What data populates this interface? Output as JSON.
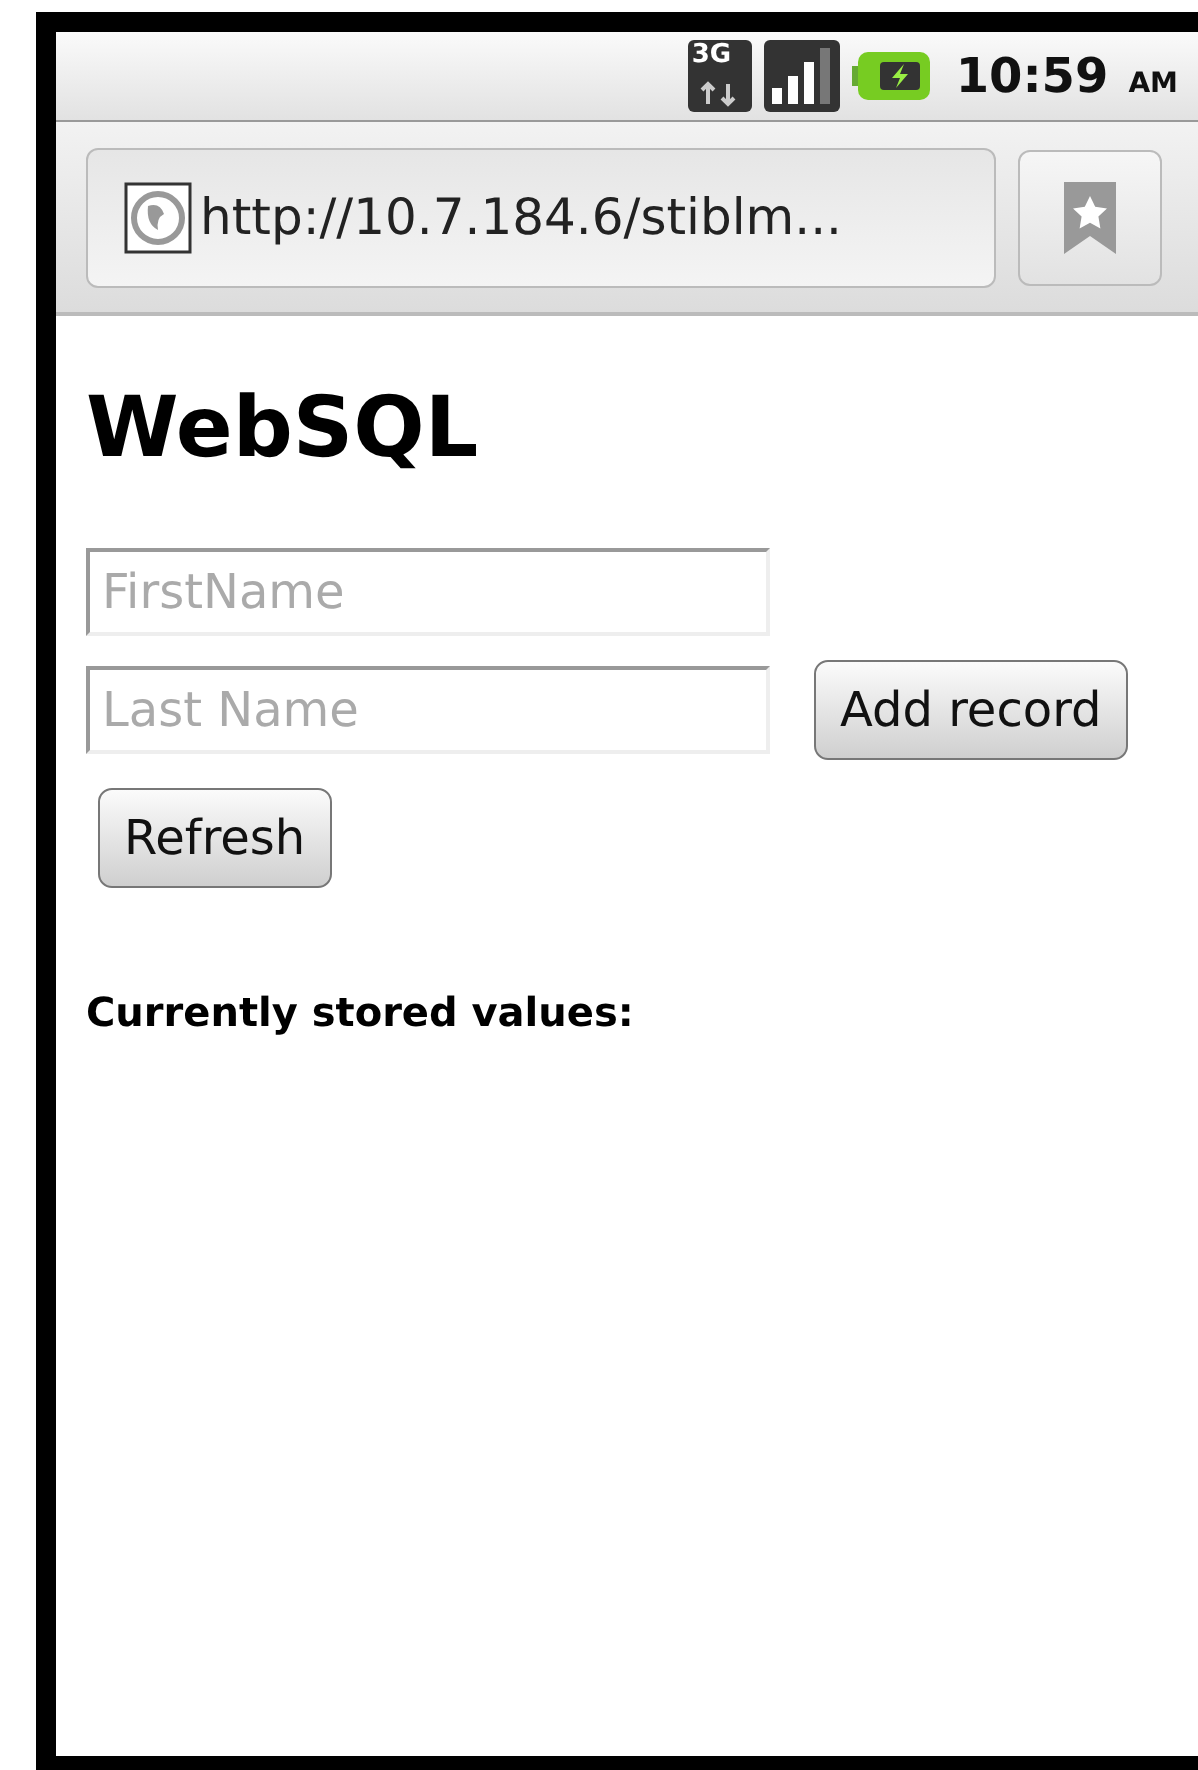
{
  "status_bar": {
    "network_label": "3G",
    "time": "10:59",
    "meridiem": "AM"
  },
  "browser": {
    "url": "http://10.7.184.6/stiblm..."
  },
  "page": {
    "title": "WebSQL",
    "fields": [
      {
        "placeholder": "FirstName"
      },
      {
        "placeholder": "Last Name"
      }
    ],
    "add_button": "Add record",
    "refresh_button": "Refresh",
    "stored_label": "Currently stored values:"
  }
}
